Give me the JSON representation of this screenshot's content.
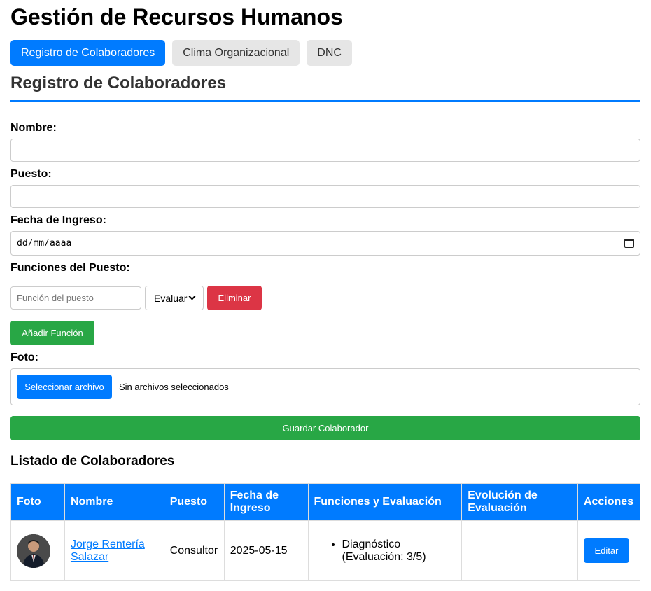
{
  "app_title": "Gestión de Recursos Humanos",
  "tabs": [
    {
      "label": "Registro de Colaboradores",
      "active": true
    },
    {
      "label": "Clima Organizacional",
      "active": false
    },
    {
      "label": "DNC",
      "active": false
    }
  ],
  "form": {
    "title": "Registro de Colaboradores",
    "nombre_label": "Nombre:",
    "nombre_value": "",
    "puesto_label": "Puesto:",
    "puesto_value": "",
    "fecha_label": "Fecha de Ingreso:",
    "fecha_value": "dd/mm/aaaa",
    "funciones_label": "Funciones del Puesto:",
    "funcion_placeholder": "Función del puesto",
    "evaluar_selected": "Evaluar",
    "eliminar_label": "Eliminar",
    "add_funcion_label": "Añadir Función",
    "foto_label": "Foto:",
    "file_button_label": "Seleccionar archivo",
    "file_status": "Sin archivos seleccionados",
    "save_label": "Guardar Colaborador"
  },
  "list": {
    "title": "Listado de Colaboradores",
    "headers": [
      "Foto",
      "Nombre",
      "Puesto",
      "Fecha de Ingreso",
      "Funciones y Evaluación",
      "Evolución de Evaluación",
      "Acciones"
    ],
    "rows": [
      {
        "nombre": "Jorge Rentería Salazar",
        "puesto": "Consultor",
        "fecha": "2025-05-15",
        "funcion": "Diagnóstico (Evaluación: 3/5)",
        "evolucion": "",
        "accion_label": "Editar"
      }
    ]
  },
  "colors": {
    "primary": "#007bff",
    "success": "#28a745",
    "danger": "#dc3545"
  }
}
